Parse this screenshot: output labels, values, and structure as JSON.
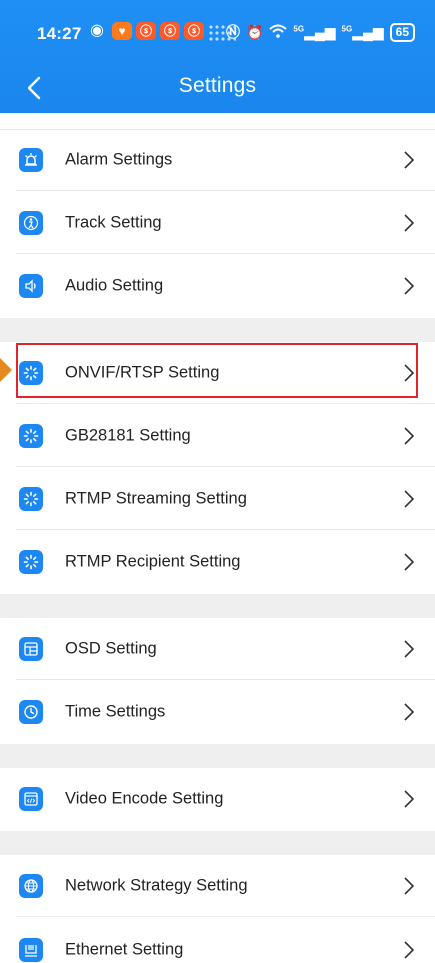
{
  "status_bar": {
    "time": "14:27",
    "network_label": "5G",
    "network_label_2": "5G",
    "battery": "65"
  },
  "header": {
    "title": "Settings"
  },
  "colors": {
    "header_blue": "#1a86ee",
    "icon_blue": "#1e88f2",
    "highlight_red": "#e0242b",
    "group_gap": "#efefef"
  },
  "items": [
    {
      "label": "Alarm Settings",
      "icon": "alarm-icon"
    },
    {
      "label": "Track Setting",
      "icon": "track-icon"
    },
    {
      "label": "Audio Setting",
      "icon": "audio-icon"
    },
    {
      "label": "ONVIF/RTSP Setting",
      "icon": "stream-icon",
      "highlighted": true
    },
    {
      "label": "GB28181 Setting",
      "icon": "stream-icon"
    },
    {
      "label": "RTMP Streaming Setting",
      "icon": "stream-icon"
    },
    {
      "label": "RTMP Recipient Setting",
      "icon": "stream-icon"
    },
    {
      "label": "OSD Setting",
      "icon": "osd-icon"
    },
    {
      "label": "Time Settings",
      "icon": "clock-icon"
    },
    {
      "label": "Video Encode Setting",
      "icon": "code-icon"
    },
    {
      "label": "Network Strategy Setting",
      "icon": "globe-icon"
    },
    {
      "label": "Ethernet Setting",
      "icon": "ethernet-icon"
    }
  ]
}
